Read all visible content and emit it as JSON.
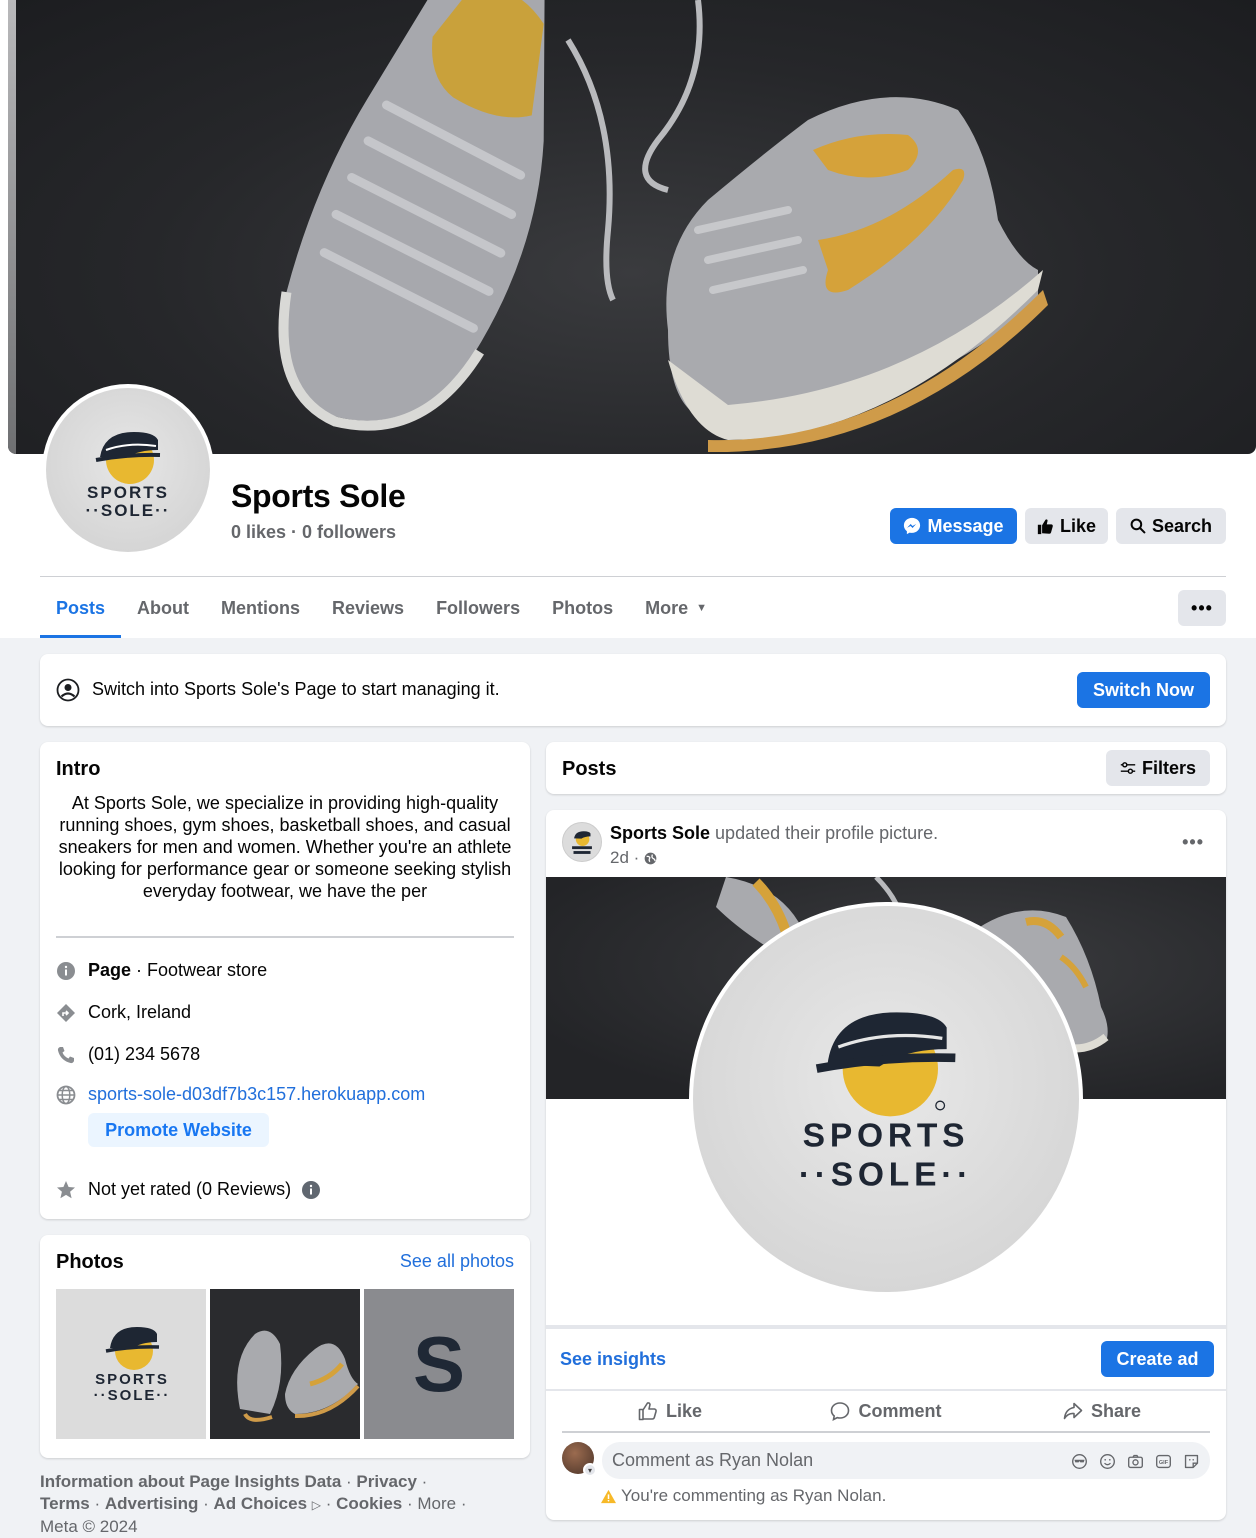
{
  "page": {
    "name": "Sports Sole",
    "stats": "0 likes · 0 followers"
  },
  "logo": {
    "line1": "SPORTS",
    "line2": "··SOLE··"
  },
  "header_buttons": {
    "message": "Message",
    "like": "Like",
    "search": "Search"
  },
  "tabs": {
    "posts": "Posts",
    "about": "About",
    "mentions": "Mentions",
    "reviews": "Reviews",
    "followers": "Followers",
    "photos": "Photos",
    "more": "More"
  },
  "switch_banner": {
    "text": "Switch into Sports Sole's Page to start managing it.",
    "button": "Switch Now"
  },
  "intro": {
    "title": "Intro",
    "description": "At Sports Sole, we specialize in providing high-quality running shoes, gym shoes, basketball shoes, and casual sneakers for men and women. Whether you're an athlete looking for performance gear or someone seeking stylish everyday footwear, we have the per",
    "category_label": "Page",
    "category_value": "· Footwear store",
    "location": "Cork, Ireland",
    "phone": "(01) 234 5678",
    "website": "sports-sole-d03df7b3c157.herokuapp.com",
    "promote_button": "Promote Website",
    "rating": "Not yet rated (0 Reviews)"
  },
  "photos": {
    "title": "Photos",
    "see_all": "See all photos",
    "third_letter": "S"
  },
  "footer": {
    "l1": "Information about Page Insights Data",
    "l2": "Privacy",
    "l3": "Terms",
    "l4": "Advertising",
    "l5": "Ad Choices",
    "l6": "Cookies",
    "l7": "More",
    "l8": "Meta © 2024"
  },
  "posts": {
    "title": "Posts",
    "filters": "Filters"
  },
  "post": {
    "author": "Sports Sole",
    "action": "updated their profile picture.",
    "time": "2d ·",
    "see_insights": "See insights",
    "create_ad": "Create ad",
    "like": "Like",
    "comment": "Comment",
    "share": "Share",
    "comment_placeholder": "Comment as Ryan Nolan",
    "commenting_notice": "You're commenting as Ryan Nolan."
  },
  "colors": {
    "accent": "#1b74e4",
    "link": "#216fdb",
    "logo_yellow": "#e8b830",
    "logo_dark": "#1e2633"
  }
}
